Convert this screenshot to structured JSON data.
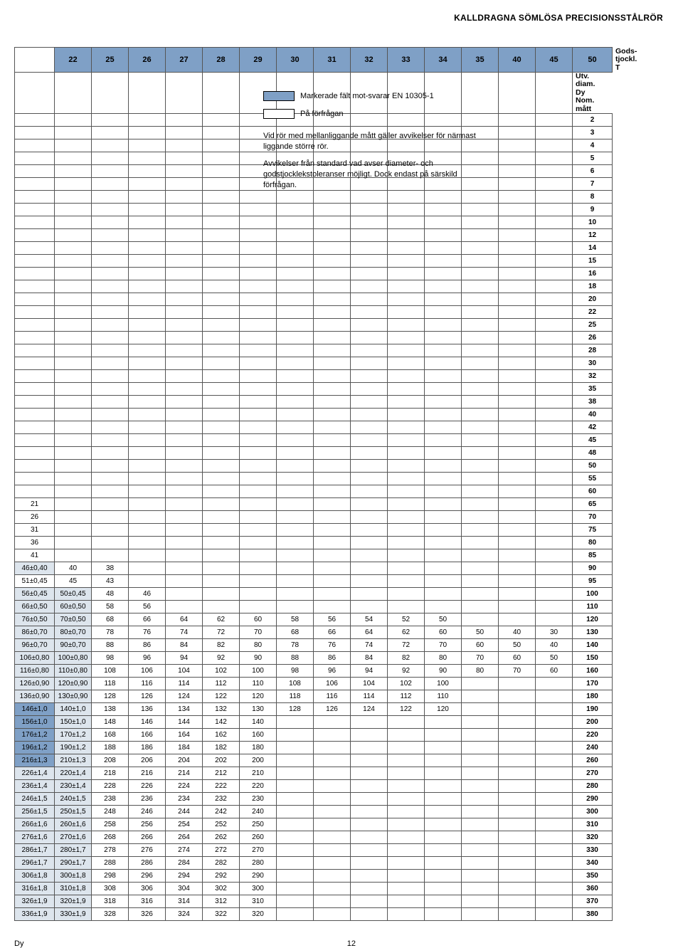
{
  "page_title": "KALLDRAGNA SÖMLÖSA PRECISIONSSTÅLRÖR",
  "footer_left": "Dy",
  "footer_page": "12",
  "columns": [
    "22",
    "25",
    "26",
    "27",
    "28",
    "29",
    "30",
    "31",
    "32",
    "33",
    "34",
    "35",
    "40",
    "45",
    "50"
  ],
  "right_header_top": "Gods-\ntjockl.\nT",
  "right_header_sub": "Utv.\ndiam.\nDy\nNom.\nmått",
  "legend": {
    "marked": "Markerade fält mot-svarar EN 10305-1",
    "onreq": "På förfrågan",
    "note1": "Vid rör med mellanliggande mått gäller avvikelser för närmast liggande större rör.",
    "note2": "Avvikelser från standard vad avser diameter- och godstjocklekstoleranser möjligt. Dock endast på särskild förfrågan."
  },
  "right_values": [
    "2",
    "3",
    "4",
    "5",
    "6",
    "7",
    "8",
    "9",
    "10",
    "12",
    "14",
    "15",
    "16",
    "18",
    "20",
    "22",
    "25",
    "26",
    "28",
    "30",
    "32",
    "35",
    "38",
    "40",
    "42",
    "45",
    "48",
    "50",
    "55",
    "60",
    "65",
    "70",
    "75",
    "80",
    "85",
    "90",
    "95",
    "100",
    "110",
    "120",
    "130",
    "140",
    "150",
    "160",
    "170",
    "180",
    "190",
    "200",
    "220",
    "240",
    "260",
    "270",
    "280",
    "290",
    "300",
    "310",
    "320",
    "330",
    "340",
    "350",
    "360",
    "370",
    "380"
  ],
  "rows": [
    {
      "r": 30,
      "cells": [
        "21",
        "",
        "",
        "",
        "",
        "",
        "",
        "",
        "",
        "",
        "",
        "",
        "",
        "",
        "",
        ""
      ]
    },
    {
      "r": 31,
      "cells": [
        "26",
        "",
        "",
        "",
        "",
        "",
        "",
        "",
        "",
        "",
        "",
        "",
        "",
        "",
        "",
        ""
      ]
    },
    {
      "r": 32,
      "cells": [
        "31",
        "",
        "",
        "",
        "",
        "",
        "",
        "",
        "",
        "",
        "",
        "",
        "",
        "",
        "",
        ""
      ]
    },
    {
      "r": 33,
      "cells": [
        "36",
        "",
        "",
        "",
        "",
        "",
        "",
        "",
        "",
        "",
        "",
        "",
        "",
        "",
        "",
        ""
      ]
    },
    {
      "r": 34,
      "cells": [
        "41",
        "",
        "",
        "",
        "",
        "",
        "",
        "",
        "",
        "",
        "",
        "",
        "",
        "",
        "",
        ""
      ]
    },
    {
      "r": 35,
      "cells": [
        "46±0,40",
        "40",
        "38",
        "",
        "",
        "",
        "",
        "",
        "",
        "",
        "",
        "",
        "",
        "",
        "",
        ""
      ],
      "shade": [
        0
      ]
    },
    {
      "r": 36,
      "cells": [
        "51±0,45",
        "45",
        "43",
        "",
        "",
        "",
        "",
        "",
        "",
        "",
        "",
        "",
        "",
        "",
        "",
        ""
      ]
    },
    {
      "r": 37,
      "cells": [
        "56±0,45",
        "50±0,45",
        "48",
        "46",
        "",
        "",
        "",
        "",
        "",
        "",
        "",
        "",
        "",
        "",
        "",
        ""
      ],
      "shade": [
        0,
        1
      ]
    },
    {
      "r": 38,
      "cells": [
        "66±0,50",
        "60±0,50",
        "58",
        "56",
        "",
        "",
        "",
        "",
        "",
        "",
        "",
        "",
        "",
        "",
        "",
        ""
      ],
      "shade": [
        0,
        1
      ]
    },
    {
      "r": 39,
      "cells": [
        "76±0,50",
        "70±0,50",
        "68",
        "66",
        "64",
        "62",
        "60",
        "58",
        "56",
        "54",
        "52",
        "50",
        "",
        "",
        "",
        ""
      ],
      "shade": [
        0,
        1
      ]
    },
    {
      "r": 40,
      "cells": [
        "86±0,70",
        "80±0,70",
        "78",
        "76",
        "74",
        "72",
        "70",
        "68",
        "66",
        "64",
        "62",
        "60",
        "50",
        "40",
        "30",
        ""
      ],
      "shade": [
        0,
        1
      ]
    },
    {
      "r": 41,
      "cells": [
        "96±0,70",
        "90±0,70",
        "88",
        "86",
        "84",
        "82",
        "80",
        "78",
        "76",
        "74",
        "72",
        "70",
        "60",
        "50",
        "40",
        ""
      ],
      "shade": [
        0,
        1
      ]
    },
    {
      "r": 42,
      "cells": [
        "106±0,80",
        "100±0,80",
        "98",
        "96",
        "94",
        "92",
        "90",
        "88",
        "86",
        "84",
        "82",
        "80",
        "70",
        "60",
        "50",
        ""
      ],
      "shade": [
        0,
        1
      ]
    },
    {
      "r": 43,
      "cells": [
        "116±0,80",
        "110±0,80",
        "108",
        "106",
        "104",
        "102",
        "100",
        "98",
        "96",
        "94",
        "92",
        "90",
        "80",
        "70",
        "60",
        ""
      ],
      "shade": [
        0,
        1
      ]
    },
    {
      "r": 44,
      "cells": [
        "126±0,90",
        "120±0,90",
        "118",
        "116",
        "114",
        "112",
        "110",
        "108",
        "106",
        "104",
        "102",
        "100",
        "",
        "",
        "",
        ""
      ],
      "shade": [
        0,
        1
      ]
    },
    {
      "r": 45,
      "cells": [
        "136±0,90",
        "130±0,90",
        "128",
        "126",
        "124",
        "122",
        "120",
        "118",
        "116",
        "114",
        "112",
        "110",
        "",
        "",
        "",
        ""
      ],
      "shade": [
        0,
        1
      ]
    },
    {
      "r": 46,
      "cells": [
        "146±1,0",
        "140±1,0",
        "138",
        "136",
        "134",
        "132",
        "130",
        "128",
        "126",
        "124",
        "122",
        "120",
        "",
        "",
        "",
        ""
      ],
      "shade": [
        1
      ],
      "mark": [
        0
      ]
    },
    {
      "r": 47,
      "cells": [
        "156±1,0",
        "150±1,0",
        "148",
        "146",
        "144",
        "142",
        "140",
        "",
        "",
        "",
        "",
        "",
        "",
        "",
        "",
        ""
      ],
      "shade": [
        1
      ],
      "mark": [
        0
      ]
    },
    {
      "r": 48,
      "cells": [
        "176±1,2",
        "170±1,2",
        "168",
        "166",
        "164",
        "162",
        "160",
        "",
        "",
        "",
        "",
        "",
        "",
        "",
        "",
        ""
      ],
      "shade": [
        1
      ],
      "mark": [
        0
      ]
    },
    {
      "r": 49,
      "cells": [
        "196±1,2",
        "190±1,2",
        "188",
        "186",
        "184",
        "182",
        "180",
        "",
        "",
        "",
        "",
        "",
        "",
        "",
        "",
        ""
      ],
      "shade": [
        1
      ],
      "mark": [
        0
      ]
    },
    {
      "r": 50,
      "cells": [
        "216±1,3",
        "210±1,3",
        "208",
        "206",
        "204",
        "202",
        "200",
        "",
        "",
        "",
        "",
        "",
        "",
        "",
        "",
        ""
      ],
      "shade": [
        1
      ],
      "mark": [
        0
      ]
    },
    {
      "r": 51,
      "cells": [
        "226±1,4",
        "220±1,4",
        "218",
        "216",
        "214",
        "212",
        "210",
        "",
        "",
        "",
        "",
        "",
        "",
        "",
        "",
        ""
      ],
      "shade": [
        0,
        1
      ]
    },
    {
      "r": 52,
      "cells": [
        "236±1,4",
        "230±1,4",
        "228",
        "226",
        "224",
        "222",
        "220",
        "",
        "",
        "",
        "",
        "",
        "",
        "",
        "",
        ""
      ],
      "shade": [
        0,
        1
      ]
    },
    {
      "r": 53,
      "cells": [
        "246±1,5",
        "240±1,5",
        "238",
        "236",
        "234",
        "232",
        "230",
        "",
        "",
        "",
        "",
        "",
        "",
        "",
        "",
        ""
      ],
      "shade": [
        0,
        1
      ]
    },
    {
      "r": 54,
      "cells": [
        "256±1,5",
        "250±1,5",
        "248",
        "246",
        "244",
        "242",
        "240",
        "",
        "",
        "",
        "",
        "",
        "",
        "",
        "",
        ""
      ],
      "shade": [
        0,
        1
      ]
    },
    {
      "r": 55,
      "cells": [
        "266±1,6",
        "260±1,6",
        "258",
        "256",
        "254",
        "252",
        "250",
        "",
        "",
        "",
        "",
        "",
        "",
        "",
        "",
        ""
      ],
      "shade": [
        0,
        1
      ]
    },
    {
      "r": 56,
      "cells": [
        "276±1,6",
        "270±1,6",
        "268",
        "266",
        "264",
        "262",
        "260",
        "",
        "",
        "",
        "",
        "",
        "",
        "",
        "",
        ""
      ],
      "shade": [
        0,
        1
      ]
    },
    {
      "r": 57,
      "cells": [
        "286±1,7",
        "280±1,7",
        "278",
        "276",
        "274",
        "272",
        "270",
        "",
        "",
        "",
        "",
        "",
        "",
        "",
        "",
        ""
      ],
      "shade": [
        0,
        1
      ]
    },
    {
      "r": 58,
      "cells": [
        "296±1,7",
        "290±1,7",
        "288",
        "286",
        "284",
        "282",
        "280",
        "",
        "",
        "",
        "",
        "",
        "",
        "",
        "",
        ""
      ],
      "shade": [
        0,
        1
      ]
    },
    {
      "r": 59,
      "cells": [
        "306±1,8",
        "300±1,8",
        "298",
        "296",
        "294",
        "292",
        "290",
        "",
        "",
        "",
        "",
        "",
        "",
        "",
        "",
        ""
      ],
      "shade": [
        0,
        1
      ]
    },
    {
      "r": 60,
      "cells": [
        "316±1,8",
        "310±1,8",
        "308",
        "306",
        "304",
        "302",
        "300",
        "",
        "",
        "",
        "",
        "",
        "",
        "",
        "",
        ""
      ],
      "shade": [
        0,
        1
      ]
    },
    {
      "r": 61,
      "cells": [
        "326±1,9",
        "320±1,9",
        "318",
        "316",
        "314",
        "312",
        "310",
        "",
        "",
        "",
        "",
        "",
        "",
        "",
        "",
        ""
      ],
      "shade": [
        0,
        1
      ]
    },
    {
      "r": 62,
      "cells": [
        "336±1,9",
        "330±1,9",
        "328",
        "326",
        "324",
        "322",
        "320",
        "",
        "",
        "",
        "",
        "",
        "",
        "",
        "",
        ""
      ],
      "shade": [
        0,
        1
      ]
    }
  ]
}
